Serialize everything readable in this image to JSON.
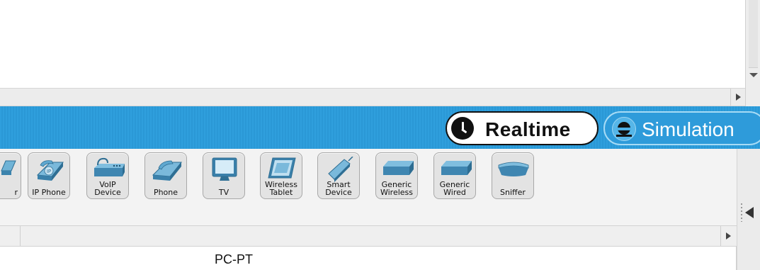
{
  "mode_bar": {
    "realtime_label": "Realtime",
    "simulation_label": "Simulation",
    "bar_color": "#2f9fdd"
  },
  "devices": [
    {
      "label": "r",
      "icon": "phone-partial-icon"
    },
    {
      "label": "IP Phone",
      "icon": "ip-phone-icon"
    },
    {
      "label": "VoIP\nDevice",
      "icon": "voip-device-icon"
    },
    {
      "label": "Phone",
      "icon": "phone-icon"
    },
    {
      "label": "TV",
      "icon": "tv-icon"
    },
    {
      "label": "Wireless\nTablet",
      "icon": "wireless-tablet-icon"
    },
    {
      "label": "Smart\nDevice",
      "icon": "smart-device-icon"
    },
    {
      "label": "Generic\nWireless",
      "icon": "generic-wireless-icon"
    },
    {
      "label": "Generic\nWired",
      "icon": "generic-wired-icon"
    },
    {
      "label": "Sniffer",
      "icon": "sniffer-icon"
    }
  ],
  "status": {
    "device_name": "PC-PT"
  }
}
